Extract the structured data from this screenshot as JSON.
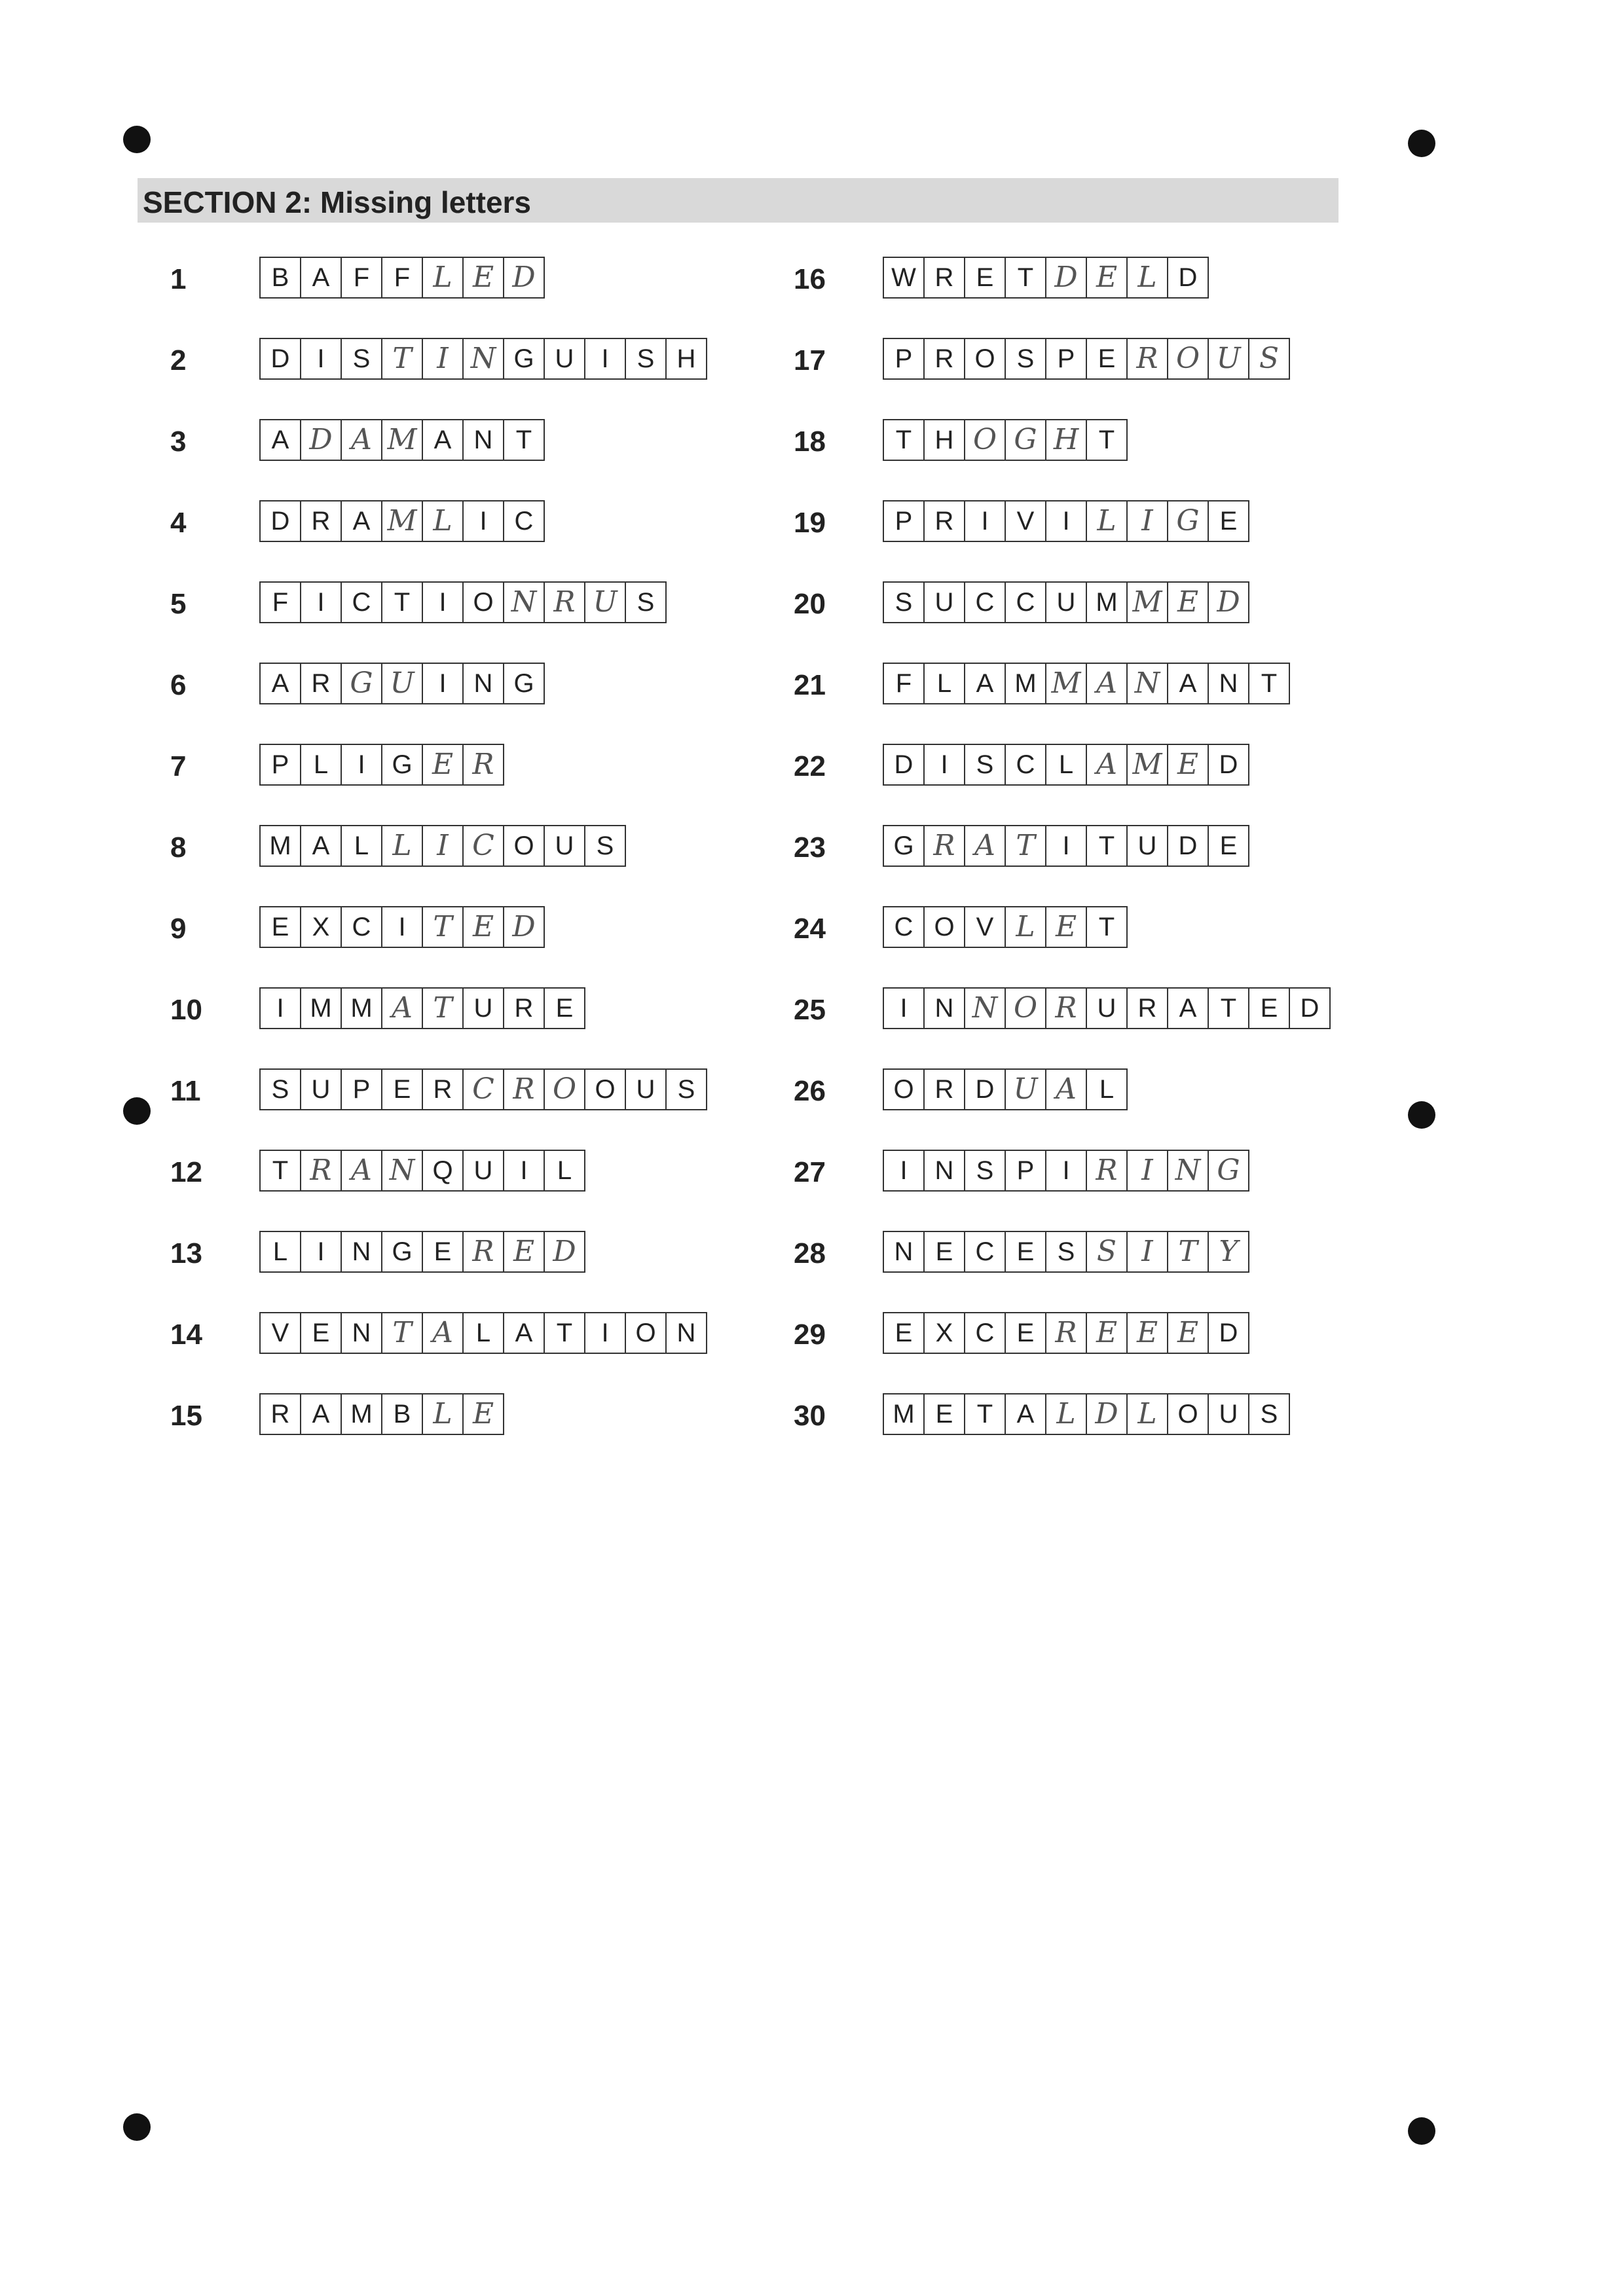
{
  "section_title": "SECTION 2: Missing letters",
  "left_questions": [
    {
      "number": "1",
      "letters": "BAFFLED",
      "handwritten": [
        5,
        6,
        7
      ]
    },
    {
      "number": "2",
      "letters": "DISTINGUISH",
      "handwritten": [
        4,
        5,
        6
      ]
    },
    {
      "number": "3",
      "letters": "ADAMANT",
      "handwritten": [
        2,
        3,
        4
      ]
    },
    {
      "number": "4",
      "letters": "DRAMLIC",
      "handwritten": [
        4,
        5
      ]
    },
    {
      "number": "5",
      "letters": "FICTIONRUS",
      "handwritten": [
        7,
        8,
        9
      ]
    },
    {
      "number": "6",
      "letters": "ARGUING",
      "handwritten": [
        3,
        4
      ]
    },
    {
      "number": "7",
      "letters": "PLIGER",
      "handwritten": [
        5,
        6
      ]
    },
    {
      "number": "8",
      "letters": "MALLICOUS",
      "handwritten": [
        4,
        5,
        6
      ]
    },
    {
      "number": "9",
      "letters": "EXCITED",
      "handwritten": [
        5,
        6,
        7
      ]
    },
    {
      "number": "10",
      "letters": "IMMATURE",
      "handwritten": [
        4,
        5
      ]
    },
    {
      "number": "11",
      "letters": "SUPERCROOUS",
      "handwritten": [
        6,
        7,
        8
      ]
    },
    {
      "number": "12",
      "letters": "TRANQUIL",
      "handwritten": [
        2,
        3,
        4
      ]
    },
    {
      "number": "13",
      "letters": "LINGERED",
      "handwritten": [
        6,
        7,
        8
      ]
    },
    {
      "number": "14",
      "letters": "VENTALATION",
      "handwritten": [
        4,
        5
      ]
    },
    {
      "number": "15",
      "letters": "RAMBLE",
      "handwritten": [
        5,
        6
      ]
    }
  ],
  "right_questions": [
    {
      "number": "16",
      "letters": "WRETDELD",
      "handwritten": [
        5,
        6,
        7
      ]
    },
    {
      "number": "17",
      "letters": "PROSPEROUS",
      "handwritten": [
        7,
        8,
        9,
        10
      ]
    },
    {
      "number": "18",
      "letters": "THOGHT",
      "handwritten": [
        3,
        4,
        5
      ]
    },
    {
      "number": "19",
      "letters": "PRIVILIGE",
      "handwritten": [
        6,
        7,
        8
      ]
    },
    {
      "number": "20",
      "letters": "SUCCUMMED",
      "handwritten": [
        7,
        8,
        9
      ]
    },
    {
      "number": "21",
      "letters": "FLAMMANANT",
      "handwritten": [
        5,
        6,
        7
      ]
    },
    {
      "number": "22",
      "letters": "DISCLAMED",
      "handwritten": [
        6,
        7,
        8
      ]
    },
    {
      "number": "23",
      "letters": "GRATITUDE",
      "handwritten": [
        2,
        3,
        4
      ]
    },
    {
      "number": "24",
      "letters": "COVLET",
      "handwritten": [
        4,
        5
      ]
    },
    {
      "number": "25",
      "letters": "INNORURATED",
      "handwritten": [
        3,
        4,
        5
      ]
    },
    {
      "number": "26",
      "letters": "ORDUAL",
      "handwritten": [
        4,
        5
      ]
    },
    {
      "number": "27",
      "letters": "INSPIRING",
      "handwritten": [
        6,
        7,
        8,
        9
      ]
    },
    {
      "number": "28",
      "letters": "NECESSITY",
      "handwritten": [
        6,
        7,
        8,
        9
      ]
    },
    {
      "number": "29",
      "letters": "EXCEREEED",
      "handwritten": [
        5,
        6,
        7,
        8
      ]
    },
    {
      "number": "30",
      "letters": "METALDLOUS",
      "handwritten": [
        5,
        6,
        7
      ]
    }
  ]
}
